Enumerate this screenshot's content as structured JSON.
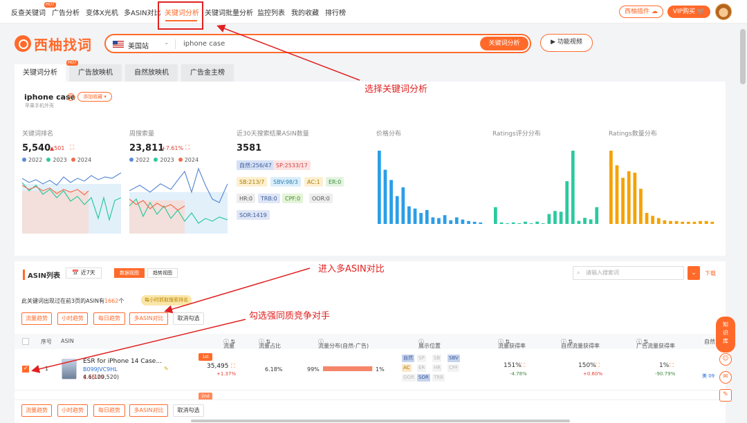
{
  "topnav": {
    "items": [
      "反查关键词",
      "广告分析",
      "变体X光机",
      "多ASIN对比",
      "关键词分析",
      "关键词批量分析",
      "监控列表",
      "我的收藏",
      "排行榜"
    ],
    "hot": "HOT",
    "plugin": "西柚插件",
    "vip": "VIP购买"
  },
  "logo": "西柚找词",
  "search": {
    "site": "美国站",
    "query": "iphone case",
    "button": "关键词分析"
  },
  "video_button": "功能视频",
  "tabs": [
    "关键词分析",
    "广告放映机",
    "自然放映机",
    "广告金主榜"
  ],
  "tab_hot": "HOT",
  "keyword": {
    "title": "iphone case",
    "count": "8",
    "fav": "添加收藏",
    "sub": "苹果手机外壳"
  },
  "metrics": {
    "rank": {
      "label": "关键词排名",
      "value": "5,540",
      "delta": "▲501"
    },
    "volume": {
      "label": "周搜索量",
      "value": "23,811",
      "delta": "+7.61%"
    },
    "asin": {
      "label": "近30天搜索结果ASIN数量",
      "value": "3581"
    },
    "price": {
      "label": "价格分布"
    },
    "ratings": {
      "label": "Ratings评分分布"
    },
    "rating_count": {
      "label": "Ratings数量分布"
    },
    "years": [
      "2022",
      "2023",
      "2024"
    ]
  },
  "asin_tags": [
    {
      "text": "自然:256/47",
      "bg": "#d5e0f5",
      "fg": "#3a5a9a"
    },
    {
      "text": "SP:2533/17",
      "bg": "#fde3e3",
      "fg": "#c44"
    },
    {
      "text": "SB:213/7",
      "bg": "#fdf0d0",
      "fg": "#a77b00"
    },
    {
      "text": "SBV:98/3",
      "bg": "#dbeefa",
      "fg": "#2a7fb6"
    },
    {
      "text": "AC:1",
      "bg": "#fdf0d0",
      "fg": "#a77b00"
    },
    {
      "text": "ER:0",
      "bg": "#e3f4e0",
      "fg": "#3d8a3d"
    },
    {
      "text": "HR:0",
      "bg": "#eeeeee",
      "fg": "#555"
    },
    {
      "text": "TRB:0",
      "bg": "#dfe6f6",
      "fg": "#3a5a9a"
    },
    {
      "text": "CPF:0",
      "bg": "#e3f4d8",
      "fg": "#4a8a2a"
    },
    {
      "text": "OOR:0",
      "bg": "#eeeeee",
      "fg": "#555"
    },
    {
      "text": "SOR:1419",
      "bg": "#dfe6f6",
      "fg": "#3a5a9a"
    }
  ],
  "chart_data": [
    {
      "type": "bar",
      "title": "价格分布",
      "color": "#2a9ee8",
      "values": [
        100,
        74,
        60,
        38,
        50,
        24,
        21,
        15,
        19,
        9,
        8,
        12,
        5,
        9,
        6,
        4,
        3,
        2
      ]
    },
    {
      "type": "bar",
      "title": "Ratings评分分布",
      "color": "#2cc9a0",
      "values": [
        22,
        2,
        0,
        2,
        1,
        3,
        0,
        3,
        0,
        13,
        17,
        16,
        56,
        96,
        4,
        8,
        6,
        22
      ]
    },
    {
      "type": "bar",
      "title": "Ratings数量分布",
      "color": "#f5a200",
      "values": [
        100,
        80,
        63,
        72,
        70,
        48,
        15,
        11,
        8,
        5,
        4,
        4,
        3,
        3,
        3,
        4,
        4,
        3
      ]
    }
  ],
  "asin_section": {
    "title": "ASIN列表",
    "range": "近7天",
    "view_data": "数据视图",
    "view_trend": "趋势视图",
    "search_placeholder": "请输入搜索词",
    "download": "下载",
    "notice_pre": "此关键词出现过在前3页的ASIN有",
    "notice_num": "1662",
    "notice_post": "个",
    "notice_badge": "每小时抓取搜索排名",
    "ops": [
      "流量趋势",
      "小时趋势",
      "每日趋势",
      "多ASIN对比",
      "取消勾选"
    ]
  },
  "table": {
    "headers": [
      "序号",
      "ASIN",
      "流量",
      "流量占比",
      "流量分布(自然-广告)",
      "展示位置",
      "流量获得率",
      "自然流量获得率",
      "广告流量获得率",
      "自然"
    ],
    "row": {
      "index": "1",
      "title": "ESR for iPhone 14 Case...",
      "asin": "B099JVC9HL",
      "price": "$ 15.29",
      "rating": "4.6(100,520)",
      "rank_badge": "1st",
      "traffic": "35,495",
      "traffic_delta": "+1.37%",
      "share": "6.18%",
      "dist_left": "99%",
      "dist_right": "1%",
      "dist_fill": 0.99,
      "positions": [
        "自然",
        "SP",
        "SB",
        "SBV",
        "AC",
        "ER",
        "HR",
        "CPF",
        "OOR",
        "SOR",
        "TRB"
      ],
      "rate": "151%",
      "rate_delta": "-4.78%",
      "nat_rate": "150%",
      "nat_delta": "+0.60%",
      "ad_rate": "1%",
      "ad_delta": "-90.79%",
      "clip": "美 09"
    },
    "rank_badge2": "2nd"
  },
  "side": {
    "knowledge": "知识库"
  },
  "annotations": {
    "a1": "选择关键词分析",
    "a2": "进入多ASIN对比",
    "a3": "勾选强同质竞争对手"
  }
}
